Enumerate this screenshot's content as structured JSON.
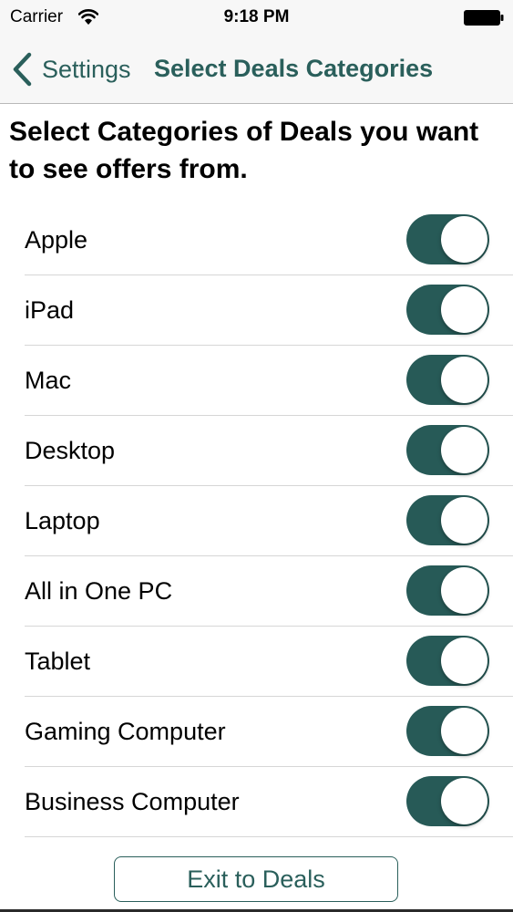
{
  "status_bar": {
    "carrier": "Carrier",
    "time": "9:18 PM",
    "wifi_icon": "wifi-icon",
    "battery_icon": "battery-icon"
  },
  "nav": {
    "back_label": "Settings",
    "back_icon": "chevron-left-icon",
    "title": "Select Deals Categories"
  },
  "heading": "Select Categories of Deals you want to see offers from.",
  "categories": [
    {
      "label": "Apple",
      "enabled": true
    },
    {
      "label": "iPad",
      "enabled": true
    },
    {
      "label": "Mac",
      "enabled": true
    },
    {
      "label": "Desktop",
      "enabled": true
    },
    {
      "label": "Laptop",
      "enabled": true
    },
    {
      "label": "All in One PC",
      "enabled": true
    },
    {
      "label": "Tablet",
      "enabled": true
    },
    {
      "label": "Gaming Computer",
      "enabled": true
    },
    {
      "label": "Business Computer",
      "enabled": true
    }
  ],
  "exit_button_label": "Exit to Deals",
  "colors": {
    "accent": "#2a5f5b",
    "toggle_on": "#275a57",
    "bar_background": "#f7f7f7"
  }
}
